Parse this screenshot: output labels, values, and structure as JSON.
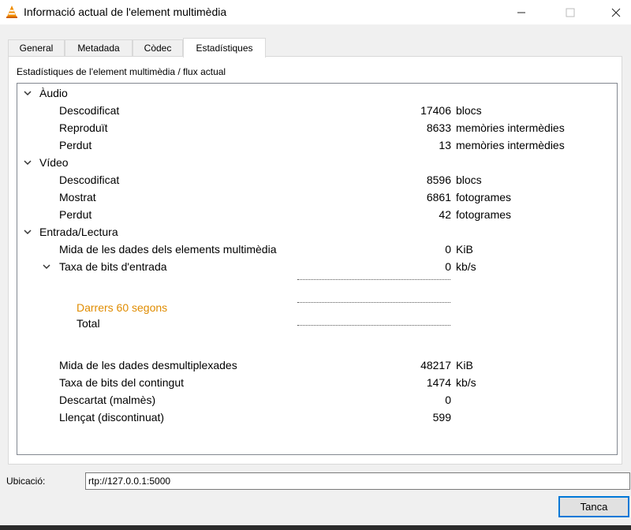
{
  "window": {
    "title": "Informació actual de l'element multimèdia",
    "minimize_icon": "minimize-icon",
    "maximize_icon": "maximize-icon",
    "close_icon": "close-icon"
  },
  "tabs": [
    {
      "label": "General"
    },
    {
      "label": "Metadada"
    },
    {
      "label": "Còdec"
    },
    {
      "label": "Estadístiques",
      "active": true
    }
  ],
  "panel": {
    "heading": "Estadístiques de l'element multimèdia / flux actual"
  },
  "tree": {
    "audio": {
      "label": "Àudio",
      "rows": [
        {
          "label": "Descodificat",
          "value": "17406",
          "unit": "blocs"
        },
        {
          "label": "Reproduït",
          "value": "8633",
          "unit": "memòries intermèdies"
        },
        {
          "label": "Perdut",
          "value": "13",
          "unit": "memòries intermèdies"
        }
      ]
    },
    "video": {
      "label": "Vídeo",
      "rows": [
        {
          "label": "Descodificat",
          "value": "8596",
          "unit": "blocs"
        },
        {
          "label": "Mostrat",
          "value": "6861",
          "unit": "fotogrames"
        },
        {
          "label": "Perdut",
          "value": "42",
          "unit": "fotogrames"
        }
      ]
    },
    "input": {
      "label": "Entrada/Lectura",
      "read_size": {
        "label": "Mida de les dades dels elements multimèdia",
        "value": "0",
        "unit": "KiB"
      },
      "bitrate": {
        "label": "Taxa de bits d'entrada",
        "value": "0",
        "unit": "kb/s",
        "last60": "Darrers 60 segons",
        "total": "Total"
      },
      "rows": [
        {
          "label": "Mida de les dades desmultiplexades",
          "value": "48217",
          "unit": "KiB"
        },
        {
          "label": "Taxa de bits del contingut",
          "value": "1474",
          "unit": "kb/s"
        },
        {
          "label": "Descartat (malmès)",
          "value": "0",
          "unit": ""
        },
        {
          "label": "Llençat (discontinuat)",
          "value": "599",
          "unit": ""
        }
      ]
    }
  },
  "location": {
    "label": "Ubicació:",
    "value": "rtp://127.0.0.1:5000"
  },
  "buttons": {
    "close": "Tanca"
  },
  "colors": {
    "accent": "#0078d7",
    "graph_label": "#e08c00"
  }
}
